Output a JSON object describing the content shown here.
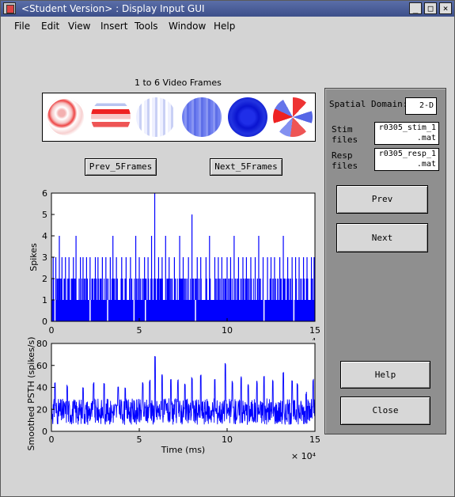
{
  "window": {
    "title": "<Student Version> : Display Input GUI",
    "controls": {
      "minimize": "_",
      "maximize": "□",
      "close": "×"
    }
  },
  "menu": [
    "File",
    "Edit",
    "View",
    "Insert",
    "Tools",
    "Window",
    "Help"
  ],
  "frames": {
    "caption": "1  to 6 Video Frames",
    "count": 6
  },
  "buttons": {
    "prev_5frames": "Prev_5Frames",
    "next_5frames": "Next_5Frames",
    "prev": "Prev",
    "next": "Next",
    "help": "Help",
    "close": "Close"
  },
  "panel": {
    "spatial_domain_label": "Spatial Domain:",
    "spatial_domain_value": "2-D",
    "stim_label_1": "Stim",
    "stim_label_2": "files",
    "stim_value_1": "r0305_stim_1",
    "stim_value_2": ".mat",
    "resp_label_1": "Resp",
    "resp_label_2": "files",
    "resp_value_1": "r0305_resp_1",
    "resp_value_2": ".mat"
  },
  "chart_data": [
    {
      "type": "bar",
      "title": "",
      "xlabel": "",
      "ylabel": "Spikes",
      "xlim": [
        0,
        150000
      ],
      "ylim": [
        0,
        6
      ],
      "xticks": [
        "0",
        "5",
        "10",
        "15"
      ],
      "yticks": [
        "0",
        "1",
        "2",
        "3",
        "4",
        "5",
        "6"
      ],
      "x_exponent": "4",
      "color": "#0000ff",
      "baseline_level": 1,
      "dense_level": 2,
      "spikes": [
        {
          "x": 1000,
          "y": 3
        },
        {
          "x": 2500,
          "y": 3
        },
        {
          "x": 4500,
          "y": 4
        },
        {
          "x": 6000,
          "y": 3
        },
        {
          "x": 8000,
          "y": 3
        },
        {
          "x": 10000,
          "y": 3
        },
        {
          "x": 12500,
          "y": 3
        },
        {
          "x": 14000,
          "y": 4
        },
        {
          "x": 16500,
          "y": 3
        },
        {
          "x": 18000,
          "y": 3
        },
        {
          "x": 20000,
          "y": 3
        },
        {
          "x": 22000,
          "y": 3
        },
        {
          "x": 25000,
          "y": 3
        },
        {
          "x": 26500,
          "y": 3
        },
        {
          "x": 29000,
          "y": 3
        },
        {
          "x": 31000,
          "y": 3
        },
        {
          "x": 33500,
          "y": 3
        },
        {
          "x": 35000,
          "y": 4
        },
        {
          "x": 37000,
          "y": 3
        },
        {
          "x": 40000,
          "y": 3
        },
        {
          "x": 42500,
          "y": 3
        },
        {
          "x": 45000,
          "y": 3
        },
        {
          "x": 48000,
          "y": 4
        },
        {
          "x": 50000,
          "y": 3
        },
        {
          "x": 53000,
          "y": 3
        },
        {
          "x": 55000,
          "y": 3
        },
        {
          "x": 57000,
          "y": 4
        },
        {
          "x": 58800,
          "y": 6
        },
        {
          "x": 61000,
          "y": 3
        },
        {
          "x": 63000,
          "y": 3
        },
        {
          "x": 65000,
          "y": 4
        },
        {
          "x": 67000,
          "y": 3
        },
        {
          "x": 70000,
          "y": 3
        },
        {
          "x": 73000,
          "y": 4
        },
        {
          "x": 75000,
          "y": 3
        },
        {
          "x": 78000,
          "y": 3
        },
        {
          "x": 80000,
          "y": 5
        },
        {
          "x": 83000,
          "y": 3
        },
        {
          "x": 85000,
          "y": 3
        },
        {
          "x": 88000,
          "y": 3
        },
        {
          "x": 90000,
          "y": 4
        },
        {
          "x": 93000,
          "y": 3
        },
        {
          "x": 95000,
          "y": 3
        },
        {
          "x": 97000,
          "y": 3
        },
        {
          "x": 100000,
          "y": 3
        },
        {
          "x": 102000,
          "y": 3
        },
        {
          "x": 104000,
          "y": 4
        },
        {
          "x": 106500,
          "y": 3
        },
        {
          "x": 109000,
          "y": 3
        },
        {
          "x": 111000,
          "y": 3
        },
        {
          "x": 113500,
          "y": 3
        },
        {
          "x": 116000,
          "y": 3
        },
        {
          "x": 118000,
          "y": 4
        },
        {
          "x": 120500,
          "y": 3
        },
        {
          "x": 123000,
          "y": 3
        },
        {
          "x": 125000,
          "y": 3
        },
        {
          "x": 127000,
          "y": 3
        },
        {
          "x": 130000,
          "y": 3
        },
        {
          "x": 132000,
          "y": 4
        },
        {
          "x": 134500,
          "y": 3
        },
        {
          "x": 137000,
          "y": 3
        },
        {
          "x": 139000,
          "y": 3
        },
        {
          "x": 141000,
          "y": 3
        },
        {
          "x": 143500,
          "y": 3
        },
        {
          "x": 145500,
          "y": 3
        },
        {
          "x": 148000,
          "y": 3
        },
        {
          "x": 149500,
          "y": 3
        }
      ],
      "gaps": [
        2000,
        22000,
        32000,
        47000,
        53500,
        82000,
        121000,
        138000
      ]
    },
    {
      "type": "line",
      "title": "",
      "xlabel": "Time (ms)",
      "ylabel": "Smoothed PSTH (spikes/s)",
      "xlim": [
        0,
        150000
      ],
      "ylim": [
        0,
        80
      ],
      "xticks": [
        "0",
        "5",
        "10",
        "15"
      ],
      "yticks": [
        "0",
        "20",
        "40",
        "60",
        "80"
      ],
      "x_exponent": "× 10⁴",
      "color": "#0000ff",
      "baseline": 18,
      "peaks": [
        {
          "x": 2000,
          "y": 45
        },
        {
          "x": 9000,
          "y": 43
        },
        {
          "x": 18000,
          "y": 40
        },
        {
          "x": 24000,
          "y": 45
        },
        {
          "x": 30000,
          "y": 44
        },
        {
          "x": 38000,
          "y": 42
        },
        {
          "x": 42000,
          "y": 40
        },
        {
          "x": 52000,
          "y": 45
        },
        {
          "x": 56000,
          "y": 47
        },
        {
          "x": 59000,
          "y": 70
        },
        {
          "x": 63000,
          "y": 52
        },
        {
          "x": 68000,
          "y": 50
        },
        {
          "x": 72000,
          "y": 47
        },
        {
          "x": 76000,
          "y": 45
        },
        {
          "x": 80000,
          "y": 49
        },
        {
          "x": 85000,
          "y": 52
        },
        {
          "x": 93000,
          "y": 48
        },
        {
          "x": 99000,
          "y": 62
        },
        {
          "x": 103000,
          "y": 46
        },
        {
          "x": 108000,
          "y": 50
        },
        {
          "x": 112000,
          "y": 44
        },
        {
          "x": 117000,
          "y": 46
        },
        {
          "x": 121000,
          "y": 51
        },
        {
          "x": 126000,
          "y": 48
        },
        {
          "x": 132000,
          "y": 55
        },
        {
          "x": 137000,
          "y": 47
        },
        {
          "x": 140000,
          "y": 44
        },
        {
          "x": 145000,
          "y": 36
        },
        {
          "x": 149000,
          "y": 48
        }
      ]
    }
  ]
}
